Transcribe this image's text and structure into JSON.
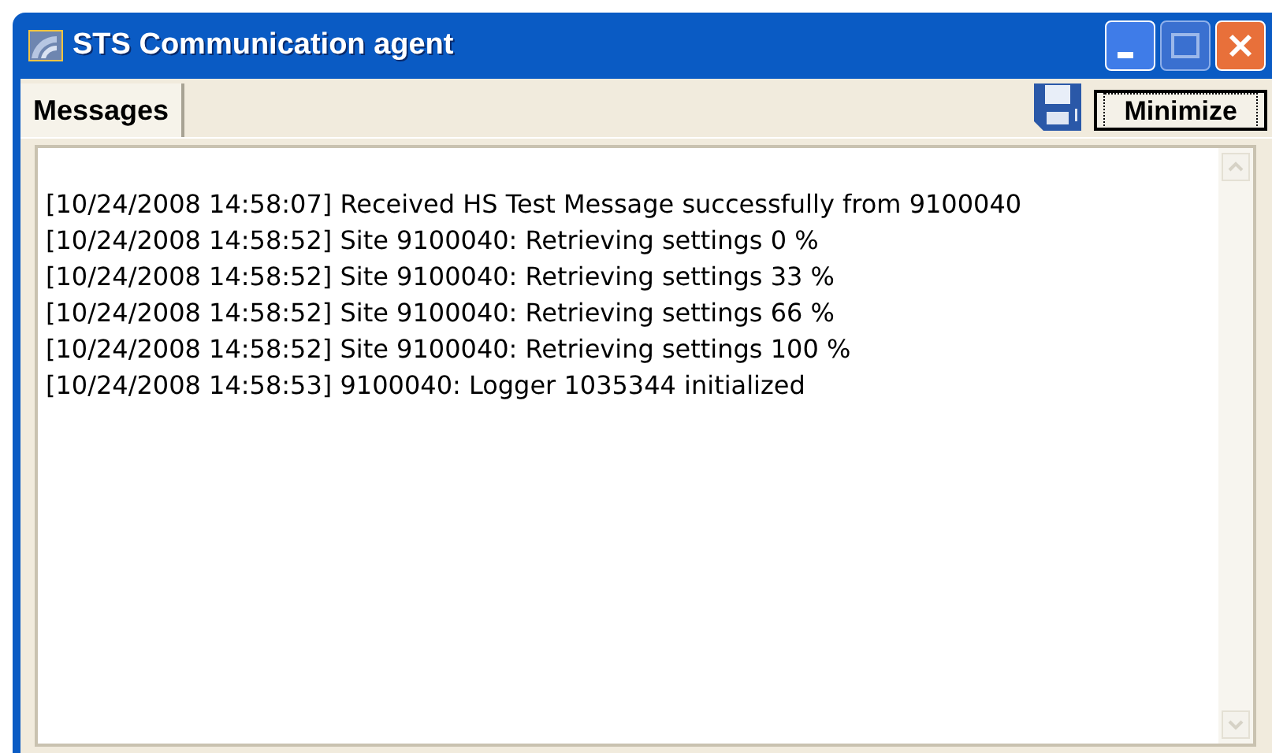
{
  "window": {
    "title": "STS Communication agent"
  },
  "tabs": [
    {
      "label": "Messages",
      "selected": true
    }
  ],
  "toolbar": {
    "minimize_button": "Minimize"
  },
  "messages": [
    "[10/24/2008 14:58:07] Received HS Test Message successfully from 9100040",
    "[10/24/2008 14:58:52] Site 9100040: Retrieving settings 0 %",
    "[10/24/2008 14:58:52] Site 9100040: Retrieving settings 33 %",
    "[10/24/2008 14:58:52] Site 9100040: Retrieving settings 66 %",
    "[10/24/2008 14:58:52] Site 9100040: Retrieving settings 100 %",
    "[10/24/2008 14:58:53] 9100040: Logger 1035344 initialized"
  ]
}
